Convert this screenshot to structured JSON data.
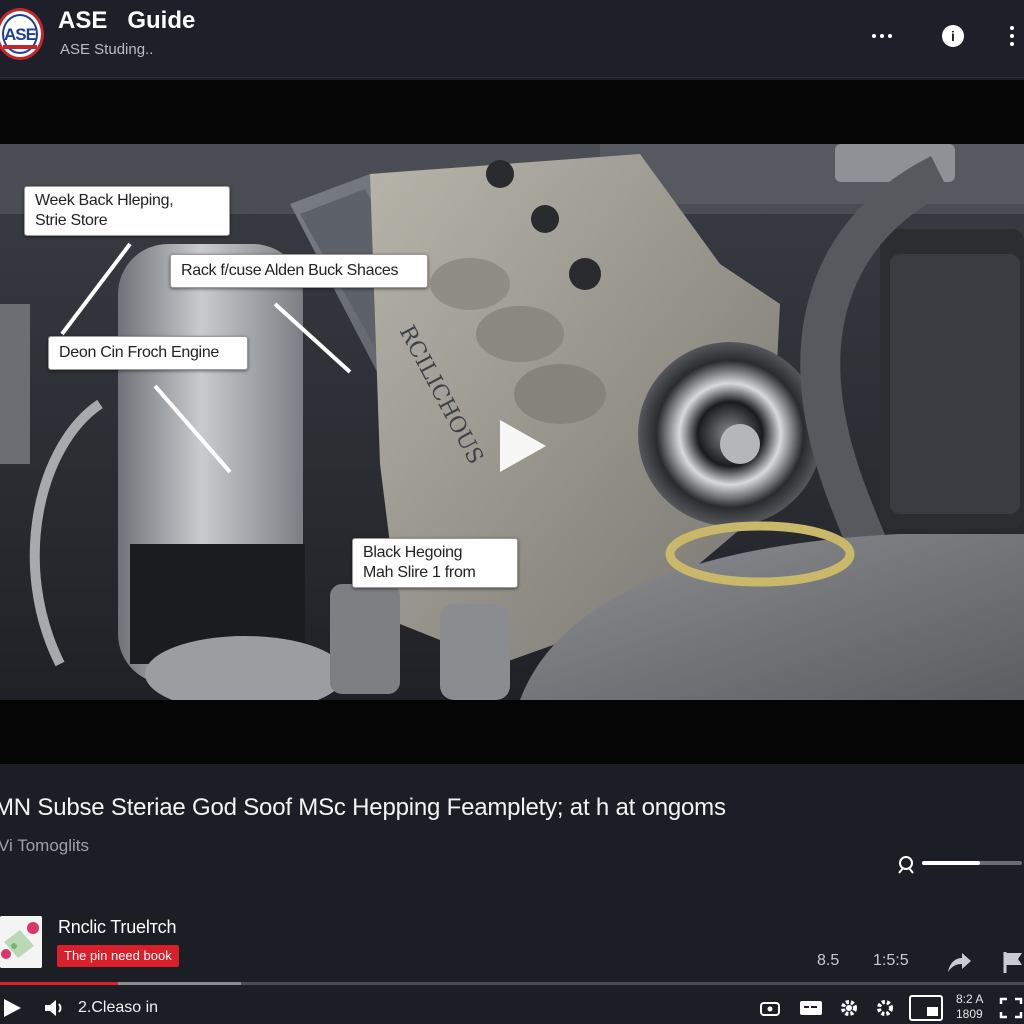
{
  "header": {
    "logo_text": "ASE",
    "title": "ASE   Guide",
    "subtitle": "ASE Studing.."
  },
  "video": {
    "callouts": [
      "Week Back Hleping,",
      "Strie Store",
      "Rack f/cuse Alden Buck Shaces",
      "Deon Cin Froch Engine",
      "Black Hegoing",
      "Mah Slire 1 from"
    ],
    "engraving": "RCILICHOUS"
  },
  "info": {
    "title": "MN Subse Steriae God Soof MSc Hepping Feamplety; at h at ongoms",
    "subtitle": "Vi Tomoglits",
    "volume_level": 0.58
  },
  "channel": {
    "name": "Rnclic Truelтch",
    "badge": "The pin need book"
  },
  "stats": {
    "value1": "8.5",
    "value2": "1:5:5"
  },
  "player": {
    "progress": 0.115,
    "buffered": 0.235,
    "time": "2.Cleaso in",
    "clock_top": "8:2 A",
    "clock_bottom": "1809"
  },
  "colors": {
    "background": "#1b1e25",
    "accent": "#e0202a",
    "badge": "#d8202a"
  },
  "icons": [
    "ase-logo",
    "more-horizontal-icon",
    "info-icon",
    "more-vertical-icon",
    "play-icon",
    "volume-icon",
    "share-icon",
    "flag-icon",
    "captions-icon",
    "subtitles-icon",
    "settings-icon",
    "miniplayer-icon",
    "fullscreen-icon"
  ]
}
